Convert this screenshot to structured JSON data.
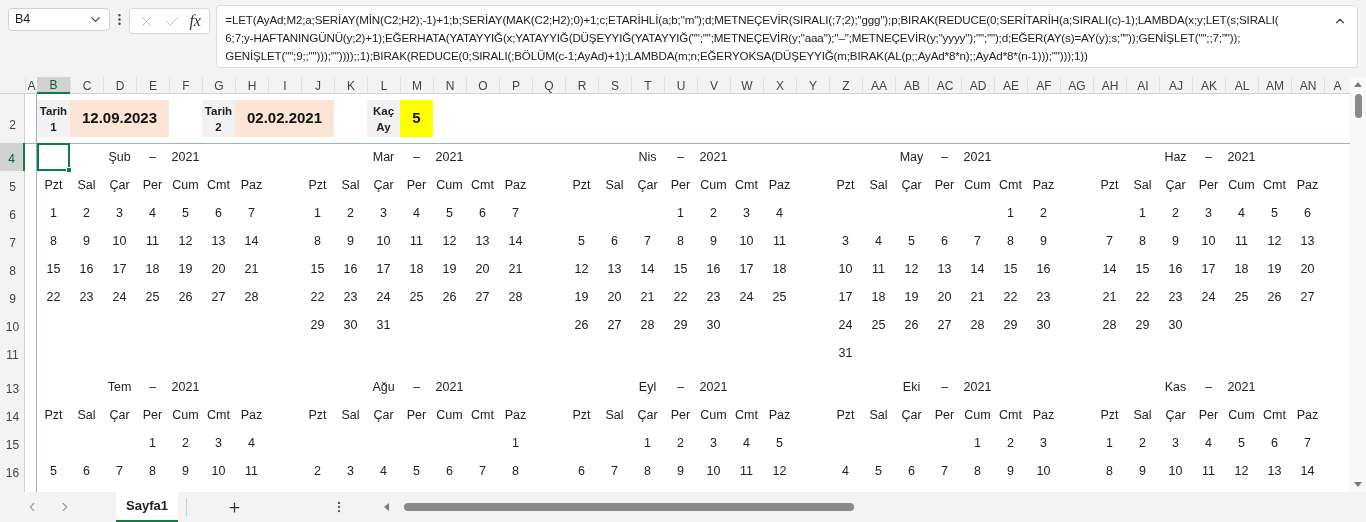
{
  "name_box": {
    "value": "B4"
  },
  "function_button": "fx",
  "formula_bar": {
    "lines": [
      "=LET(AyAd;M2;a;SERİAY(MİN(C2;H2);-1)+1;b;SERİAY(MAK(C2;H2);0)+1;c;ETARİHLİ(a;b;\"m\");d;METNEÇEVİR(SIRALI(;7;2);\"ggg\");p;BIRAK(REDUCE(0;SERİTARİH(a;SIRALI(c)-1);LAMBDA(x;y;LET(s;SIRALI(",
      "6;7;y-HAFTANINGÜNÜ(y;2)+1);EĞERHATA(YATAYYIĞ(x;YATAYYIĞ(DÜŞEYYIĞ(YATAYYIĞ(\"\";\"\";METNEÇEVİR(y;\"aaa\");\"–\";METNEÇEVİR(y;\"yyyy\");\"\";\"\");d;EĞER(AY(s)=AY(y);s;\"\"));GENİŞLET(\"\";;7;\"\"));",
      "GENİŞLET(\"\";9;;\"\")));\"\"))));;1);BIRAK(REDUCE(0;SIRALI(;BÖLÜM(c-1;AyAd)+1);LAMBDA(m;n;EĞERYOKSA(DÜŞEYYIĞ(m;BIRAK(AL(p;;AyAd*8*n);;AyAd*8*(n-1)));\"\")));1))"
    ]
  },
  "column_headers": [
    {
      "label": "A",
      "selected": false
    },
    {
      "label": "B",
      "selected": true
    },
    {
      "label": "C",
      "selected": false
    },
    {
      "label": "D",
      "selected": false
    },
    {
      "label": "E",
      "selected": false
    },
    {
      "label": "F",
      "selected": false
    },
    {
      "label": "G",
      "selected": false
    },
    {
      "label": "H",
      "selected": false
    },
    {
      "label": "I",
      "selected": false
    },
    {
      "label": "J",
      "selected": false
    },
    {
      "label": "K",
      "selected": false
    },
    {
      "label": "L",
      "selected": false
    },
    {
      "label": "M",
      "selected": false
    },
    {
      "label": "N",
      "selected": false
    },
    {
      "label": "O",
      "selected": false
    },
    {
      "label": "P",
      "selected": false
    },
    {
      "label": "Q",
      "selected": false
    },
    {
      "label": "R",
      "selected": false
    },
    {
      "label": "S",
      "selected": false
    },
    {
      "label": "T",
      "selected": false
    },
    {
      "label": "U",
      "selected": false
    },
    {
      "label": "V",
      "selected": false
    },
    {
      "label": "W",
      "selected": false
    },
    {
      "label": "X",
      "selected": false
    },
    {
      "label": "Y",
      "selected": false
    },
    {
      "label": "Z",
      "selected": false
    },
    {
      "label": "AA",
      "selected": false
    },
    {
      "label": "AB",
      "selected": false
    },
    {
      "label": "AC",
      "selected": false
    },
    {
      "label": "AD",
      "selected": false
    },
    {
      "label": "AE",
      "selected": false
    },
    {
      "label": "AF",
      "selected": false
    },
    {
      "label": "AG",
      "selected": false
    },
    {
      "label": "AH",
      "selected": false
    },
    {
      "label": "AI",
      "selected": false
    },
    {
      "label": "AJ",
      "selected": false
    },
    {
      "label": "AK",
      "selected": false
    },
    {
      "label": "AL",
      "selected": false
    },
    {
      "label": "AM",
      "selected": false
    },
    {
      "label": "AN",
      "selected": false
    },
    {
      "label": "A",
      "selected": false
    }
  ],
  "row_headers": [
    {
      "label": "2",
      "selected": false
    },
    {
      "label": "4",
      "selected": true
    },
    {
      "label": "5",
      "selected": false
    },
    {
      "label": "6",
      "selected": false
    },
    {
      "label": "7",
      "selected": false
    },
    {
      "label": "8",
      "selected": false
    },
    {
      "label": "9",
      "selected": false
    },
    {
      "label": "10",
      "selected": false
    },
    {
      "label": "11",
      "selected": false
    },
    {
      "label": "13",
      "selected": false
    },
    {
      "label": "14",
      "selected": false
    },
    {
      "label": "15",
      "selected": false
    },
    {
      "label": "16",
      "selected": false
    }
  ],
  "inputs": [
    {
      "label_lines": [
        "Tarih",
        "1"
      ],
      "value": "12.09.2023",
      "color": "#fce4d6"
    },
    {
      "label_lines": [
        "Tarih",
        "2"
      ],
      "value": "02.02.2021",
      "color": "#fce4d6"
    },
    {
      "label_lines": [
        "Kaç",
        "Ay"
      ],
      "value": "5",
      "color": "#ffff00"
    }
  ],
  "calendar_rows": [
    [
      {
        "month": "Şub",
        "dash": "–",
        "year": "2021",
        "weekdays": [
          "Pzt",
          "Sal",
          "Çar",
          "Per",
          "Cum",
          "Cmt",
          "Paz"
        ],
        "weeks": [
          [
            {
              "kind": "day",
              "text": "1"
            },
            {
              "kind": "day",
              "text": "2"
            },
            {
              "kind": "day",
              "text": "3"
            },
            {
              "kind": "day",
              "text": "4"
            },
            {
              "kind": "day",
              "text": "5"
            },
            {
              "kind": "day",
              "text": "6"
            },
            {
              "kind": "day",
              "text": "7"
            }
          ],
          [
            {
              "kind": "day",
              "text": "8"
            },
            {
              "kind": "day",
              "text": "9"
            },
            {
              "kind": "day",
              "text": "10"
            },
            {
              "kind": "day",
              "text": "11"
            },
            {
              "kind": "day",
              "text": "12"
            },
            {
              "kind": "day",
              "text": "13"
            },
            {
              "kind": "day",
              "text": "14"
            }
          ],
          [
            {
              "kind": "day",
              "text": "15"
            },
            {
              "kind": "day",
              "text": "16"
            },
            {
              "kind": "day",
              "text": "17"
            },
            {
              "kind": "day",
              "text": "18"
            },
            {
              "kind": "day",
              "text": "19"
            },
            {
              "kind": "day",
              "text": "20"
            },
            {
              "kind": "day",
              "text": "21"
            }
          ],
          [
            {
              "kind": "day",
              "text": "22"
            },
            {
              "kind": "day",
              "text": "23"
            },
            {
              "kind": "day",
              "text": "24"
            },
            {
              "kind": "day",
              "text": "25"
            },
            {
              "kind": "day",
              "text": "26"
            },
            {
              "kind": "day",
              "text": "27"
            },
            {
              "kind": "day",
              "text": "28"
            }
          ]
        ]
      },
      {
        "month": "Mar",
        "dash": "–",
        "year": "2021",
        "weekdays": [
          "Pzt",
          "Sal",
          "Çar",
          "Per",
          "Cum",
          "Cmt",
          "Paz"
        ],
        "weeks": [
          [
            {
              "kind": "day",
              "text": "1"
            },
            {
              "kind": "day",
              "text": "2"
            },
            {
              "kind": "day",
              "text": "3"
            },
            {
              "kind": "day",
              "text": "4"
            },
            {
              "kind": "day",
              "text": "5"
            },
            {
              "kind": "day",
              "text": "6"
            },
            {
              "kind": "day",
              "text": "7"
            }
          ],
          [
            {
              "kind": "day",
              "text": "8"
            },
            {
              "kind": "day",
              "text": "9"
            },
            {
              "kind": "day",
              "text": "10"
            },
            {
              "kind": "day",
              "text": "11"
            },
            {
              "kind": "day",
              "text": "12"
            },
            {
              "kind": "day",
              "text": "13"
            },
            {
              "kind": "day",
              "text": "14"
            }
          ],
          [
            {
              "kind": "day",
              "text": "15"
            },
            {
              "kind": "day",
              "text": "16"
            },
            {
              "kind": "day",
              "text": "17"
            },
            {
              "kind": "day",
              "text": "18"
            },
            {
              "kind": "day",
              "text": "19"
            },
            {
              "kind": "day",
              "text": "20"
            },
            {
              "kind": "day",
              "text": "21"
            }
          ],
          [
            {
              "kind": "day",
              "text": "22"
            },
            {
              "kind": "day",
              "text": "23"
            },
            {
              "kind": "day",
              "text": "24"
            },
            {
              "kind": "day",
              "text": "25"
            },
            {
              "kind": "day",
              "text": "26"
            },
            {
              "kind": "day",
              "text": "27"
            },
            {
              "kind": "day",
              "text": "28"
            }
          ],
          [
            {
              "kind": "day",
              "text": "29"
            },
            {
              "kind": "day",
              "text": "30"
            },
            {
              "kind": "day",
              "text": "31"
            },
            {
              "kind": "empty"
            },
            {
              "kind": "empty"
            },
            {
              "kind": "empty"
            },
            {
              "kind": "empty"
            }
          ]
        ]
      },
      {
        "month": "Nis",
        "dash": "–",
        "year": "2021",
        "weekdays": [
          "Pzt",
          "Sal",
          "Çar",
          "Per",
          "Cum",
          "Cmt",
          "Paz"
        ],
        "weeks": [
          [
            {
              "kind": "empty"
            },
            {
              "kind": "empty"
            },
            {
              "kind": "empty"
            },
            {
              "kind": "day",
              "text": "1"
            },
            {
              "kind": "day",
              "text": "2"
            },
            {
              "kind": "day",
              "text": "3"
            },
            {
              "kind": "day",
              "text": "4"
            }
          ],
          [
            {
              "kind": "day",
              "text": "5"
            },
            {
              "kind": "day",
              "text": "6"
            },
            {
              "kind": "day",
              "text": "7"
            },
            {
              "kind": "day",
              "text": "8"
            },
            {
              "kind": "day",
              "text": "9"
            },
            {
              "kind": "day",
              "text": "10"
            },
            {
              "kind": "day",
              "text": "11"
            }
          ],
          [
            {
              "kind": "day",
              "text": "12"
            },
            {
              "kind": "day",
              "text": "13"
            },
            {
              "kind": "day",
              "text": "14"
            },
            {
              "kind": "day",
              "text": "15"
            },
            {
              "kind": "day",
              "text": "16"
            },
            {
              "kind": "day",
              "text": "17"
            },
            {
              "kind": "day",
              "text": "18"
            }
          ],
          [
            {
              "kind": "day",
              "text": "19"
            },
            {
              "kind": "day",
              "text": "20"
            },
            {
              "kind": "day",
              "text": "21"
            },
            {
              "kind": "day",
              "text": "22"
            },
            {
              "kind": "day",
              "text": "23"
            },
            {
              "kind": "day",
              "text": "24"
            },
            {
              "kind": "day",
              "text": "25"
            }
          ],
          [
            {
              "kind": "day",
              "text": "26"
            },
            {
              "kind": "day",
              "text": "27"
            },
            {
              "kind": "day",
              "text": "28"
            },
            {
              "kind": "day",
              "text": "29"
            },
            {
              "kind": "day",
              "text": "30"
            },
            {
              "kind": "empty"
            },
            {
              "kind": "empty"
            }
          ]
        ]
      },
      {
        "month": "May",
        "dash": "–",
        "year": "2021",
        "weekdays": [
          "Pzt",
          "Sal",
          "Çar",
          "Per",
          "Cum",
          "Cmt",
          "Paz"
        ],
        "weeks": [
          [
            {
              "kind": "empty"
            },
            {
              "kind": "empty"
            },
            {
              "kind": "empty"
            },
            {
              "kind": "empty"
            },
            {
              "kind": "empty"
            },
            {
              "kind": "day",
              "text": "1"
            },
            {
              "kind": "day",
              "text": "2"
            }
          ],
          [
            {
              "kind": "day",
              "text": "3"
            },
            {
              "kind": "day",
              "text": "4"
            },
            {
              "kind": "day",
              "text": "5"
            },
            {
              "kind": "day",
              "text": "6"
            },
            {
              "kind": "day",
              "text": "7"
            },
            {
              "kind": "day",
              "text": "8"
            },
            {
              "kind": "day",
              "text": "9"
            }
          ],
          [
            {
              "kind": "day",
              "text": "10"
            },
            {
              "kind": "day",
              "text": "11"
            },
            {
              "kind": "day",
              "text": "12"
            },
            {
              "kind": "day",
              "text": "13"
            },
            {
              "kind": "day",
              "text": "14"
            },
            {
              "kind": "day",
              "text": "15"
            },
            {
              "kind": "day",
              "text": "16"
            }
          ],
          [
            {
              "kind": "day",
              "text": "17"
            },
            {
              "kind": "day",
              "text": "18"
            },
            {
              "kind": "day",
              "text": "19"
            },
            {
              "kind": "day",
              "text": "20"
            },
            {
              "kind": "day",
              "text": "21"
            },
            {
              "kind": "day",
              "text": "22"
            },
            {
              "kind": "day",
              "text": "23"
            }
          ],
          [
            {
              "kind": "day",
              "text": "24"
            },
            {
              "kind": "day",
              "text": "25"
            },
            {
              "kind": "day",
              "text": "26"
            },
            {
              "kind": "day",
              "text": "27"
            },
            {
              "kind": "day",
              "text": "28"
            },
            {
              "kind": "day",
              "text": "29"
            },
            {
              "kind": "day",
              "text": "30"
            }
          ],
          [
            {
              "kind": "day",
              "text": "31"
            },
            {
              "kind": "empty"
            },
            {
              "kind": "empty"
            },
            {
              "kind": "empty"
            },
            {
              "kind": "empty"
            },
            {
              "kind": "empty"
            },
            {
              "kind": "empty"
            }
          ]
        ]
      },
      {
        "month": "Haz",
        "dash": "–",
        "year": "2021",
        "weekdays": [
          "Pzt",
          "Sal",
          "Çar",
          "Per",
          "Cum",
          "Cmt",
          "Paz"
        ],
        "weeks": [
          [
            {
              "kind": "empty"
            },
            {
              "kind": "day",
              "text": "1"
            },
            {
              "kind": "day",
              "text": "2"
            },
            {
              "kind": "day",
              "text": "3"
            },
            {
              "kind": "day",
              "text": "4"
            },
            {
              "kind": "day",
              "text": "5"
            },
            {
              "kind": "day",
              "text": "6"
            }
          ],
          [
            {
              "kind": "day",
              "text": "7"
            },
            {
              "kind": "day",
              "text": "8"
            },
            {
              "kind": "day",
              "text": "9"
            },
            {
              "kind": "day",
              "text": "10"
            },
            {
              "kind": "day",
              "text": "11"
            },
            {
              "kind": "day",
              "text": "12"
            },
            {
              "kind": "day",
              "text": "13"
            }
          ],
          [
            {
              "kind": "day",
              "text": "14"
            },
            {
              "kind": "day",
              "text": "15"
            },
            {
              "kind": "day",
              "text": "16"
            },
            {
              "kind": "day",
              "text": "17"
            },
            {
              "kind": "day",
              "text": "18"
            },
            {
              "kind": "day",
              "text": "19"
            },
            {
              "kind": "day",
              "text": "20"
            }
          ],
          [
            {
              "kind": "day",
              "text": "21"
            },
            {
              "kind": "day",
              "text": "22"
            },
            {
              "kind": "day",
              "text": "23"
            },
            {
              "kind": "day",
              "text": "24"
            },
            {
              "kind": "day",
              "text": "25"
            },
            {
              "kind": "day",
              "text": "26"
            },
            {
              "kind": "day",
              "text": "27"
            }
          ],
          [
            {
              "kind": "day",
              "text": "28"
            },
            {
              "kind": "day",
              "text": "29"
            },
            {
              "kind": "day",
              "text": "30"
            },
            {
              "kind": "empty"
            },
            {
              "kind": "empty"
            },
            {
              "kind": "empty"
            },
            {
              "kind": "empty"
            }
          ]
        ]
      }
    ],
    [
      {
        "month": "Tem",
        "dash": "–",
        "year": "2021",
        "weekdays": [
          "Pzt",
          "Sal",
          "Çar",
          "Per",
          "Cum",
          "Cmt",
          "Paz"
        ],
        "weeks": [
          [
            {
              "kind": "empty"
            },
            {
              "kind": "empty"
            },
            {
              "kind": "empty"
            },
            {
              "kind": "day",
              "text": "1"
            },
            {
              "kind": "day",
              "text": "2"
            },
            {
              "kind": "day",
              "text": "3"
            },
            {
              "kind": "day",
              "text": "4"
            }
          ],
          [
            {
              "kind": "day",
              "text": "5"
            },
            {
              "kind": "day",
              "text": "6"
            },
            {
              "kind": "day",
              "text": "7"
            },
            {
              "kind": "day",
              "text": "8"
            },
            {
              "kind": "day",
              "text": "9"
            },
            {
              "kind": "day",
              "text": "10"
            },
            {
              "kind": "day",
              "text": "11"
            }
          ]
        ]
      },
      {
        "month": "Ağu",
        "dash": "–",
        "year": "2021",
        "weekdays": [
          "Pzt",
          "Sal",
          "Çar",
          "Per",
          "Cum",
          "Cmt",
          "Paz"
        ],
        "weeks": [
          [
            {
              "kind": "empty"
            },
            {
              "kind": "empty"
            },
            {
              "kind": "empty"
            },
            {
              "kind": "empty"
            },
            {
              "kind": "empty"
            },
            {
              "kind": "empty"
            },
            {
              "kind": "day",
              "text": "1"
            }
          ],
          [
            {
              "kind": "day",
              "text": "2"
            },
            {
              "kind": "day",
              "text": "3"
            },
            {
              "kind": "day",
              "text": "4"
            },
            {
              "kind": "day",
              "text": "5"
            },
            {
              "kind": "day",
              "text": "6"
            },
            {
              "kind": "day",
              "text": "7"
            },
            {
              "kind": "day",
              "text": "8"
            }
          ]
        ]
      },
      {
        "month": "Eyl",
        "dash": "–",
        "year": "2021",
        "weekdays": [
          "Pzt",
          "Sal",
          "Çar",
          "Per",
          "Cum",
          "Cmt",
          "Paz"
        ],
        "weeks": [
          [
            {
              "kind": "empty"
            },
            {
              "kind": "empty"
            },
            {
              "kind": "day",
              "text": "1"
            },
            {
              "kind": "day",
              "text": "2"
            },
            {
              "kind": "day",
              "text": "3"
            },
            {
              "kind": "day",
              "text": "4"
            },
            {
              "kind": "day",
              "text": "5"
            }
          ],
          [
            {
              "kind": "day",
              "text": "6"
            },
            {
              "kind": "day",
              "text": "7"
            },
            {
              "kind": "day",
              "text": "8"
            },
            {
              "kind": "day",
              "text": "9"
            },
            {
              "kind": "day",
              "text": "10"
            },
            {
              "kind": "day",
              "text": "11"
            },
            {
              "kind": "day",
              "text": "12"
            }
          ]
        ]
      },
      {
        "month": "Eki",
        "dash": "–",
        "year": "2021",
        "weekdays": [
          "Pzt",
          "Sal",
          "Çar",
          "Per",
          "Cum",
          "Cmt",
          "Paz"
        ],
        "weeks": [
          [
            {
              "kind": "empty"
            },
            {
              "kind": "empty"
            },
            {
              "kind": "empty"
            },
            {
              "kind": "empty"
            },
            {
              "kind": "day",
              "text": "1"
            },
            {
              "kind": "day",
              "text": "2"
            },
            {
              "kind": "day",
              "text": "3"
            }
          ],
          [
            {
              "kind": "day",
              "text": "4"
            },
            {
              "kind": "day",
              "text": "5"
            },
            {
              "kind": "day",
              "text": "6"
            },
            {
              "kind": "day",
              "text": "7"
            },
            {
              "kind": "day",
              "text": "8"
            },
            {
              "kind": "day",
              "text": "9"
            },
            {
              "kind": "day",
              "text": "10"
            }
          ]
        ]
      },
      {
        "month": "Kas",
        "dash": "–",
        "year": "2021",
        "weekdays": [
          "Pzt",
          "Sal",
          "Çar",
          "Per",
          "Cum",
          "Cmt",
          "Paz"
        ],
        "weeks": [
          [
            {
              "kind": "day",
              "text": "1"
            },
            {
              "kind": "day",
              "text": "2"
            },
            {
              "kind": "day",
              "text": "3"
            },
            {
              "kind": "day",
              "text": "4"
            },
            {
              "kind": "day",
              "text": "5"
            },
            {
              "kind": "day",
              "text": "6"
            },
            {
              "kind": "day",
              "text": "7"
            }
          ],
          [
            {
              "kind": "day",
              "text": "8"
            },
            {
              "kind": "day",
              "text": "9"
            },
            {
              "kind": "day",
              "text": "10"
            },
            {
              "kind": "day",
              "text": "11"
            },
            {
              "kind": "day",
              "text": "12"
            },
            {
              "kind": "day",
              "text": "13"
            },
            {
              "kind": "day",
              "text": "14"
            }
          ]
        ]
      }
    ]
  ],
  "sheet_tabs": [
    {
      "label": "Sayfa1",
      "selected": true
    }
  ]
}
